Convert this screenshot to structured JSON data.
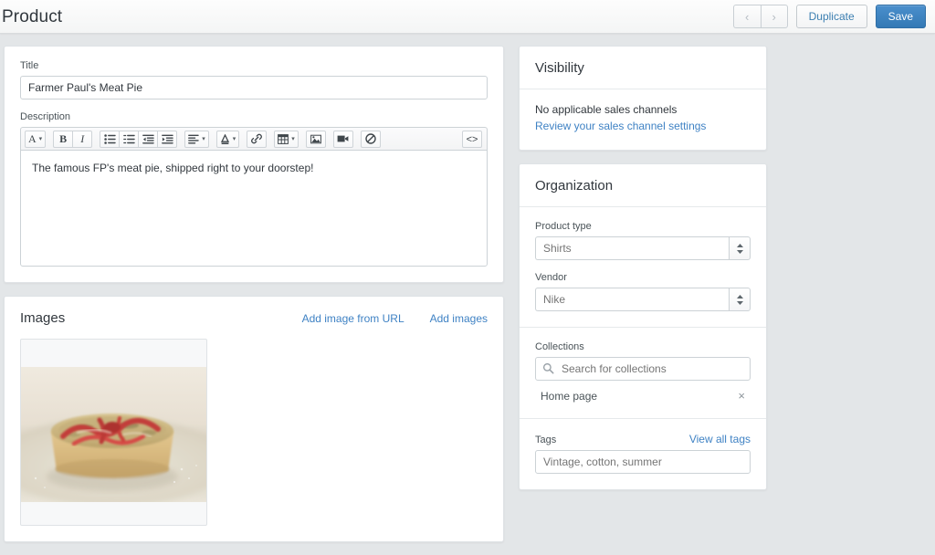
{
  "topbar": {
    "title": "Product",
    "prev_label": "‹",
    "next_label": "›",
    "duplicate_label": "Duplicate",
    "save_label": "Save"
  },
  "product": {
    "title_label": "Title",
    "title_value": "Farmer Paul's Meat Pie",
    "description_label": "Description",
    "description_value": "The famous FP's meat pie, shipped right to your doorstep!"
  },
  "editor_toolbar": {
    "groups": [
      {
        "buttons": [
          {
            "name": "font-style-icon",
            "glyph": "A",
            "caret": true
          }
        ]
      },
      {
        "buttons": [
          {
            "name": "bold-icon",
            "glyph": "B",
            "caret": false
          },
          {
            "name": "italic-icon",
            "glyph": "I",
            "caret": false
          }
        ]
      },
      {
        "buttons": [
          {
            "name": "bulleted-list-icon",
            "glyph": "",
            "caret": false
          },
          {
            "name": "numbered-list-icon",
            "glyph": "",
            "caret": false
          },
          {
            "name": "outdent-icon",
            "glyph": "",
            "caret": false
          },
          {
            "name": "indent-icon",
            "glyph": "",
            "caret": false
          }
        ]
      },
      {
        "buttons": [
          {
            "name": "align-icon",
            "glyph": "",
            "caret": true
          }
        ]
      },
      {
        "buttons": [
          {
            "name": "text-color-icon",
            "glyph": "A",
            "caret": true
          }
        ]
      },
      {
        "buttons": [
          {
            "name": "link-icon",
            "glyph": "",
            "caret": false
          }
        ]
      },
      {
        "buttons": [
          {
            "name": "table-icon",
            "glyph": "",
            "caret": true
          }
        ]
      },
      {
        "buttons": [
          {
            "name": "insert-image-icon",
            "glyph": "",
            "caret": false
          }
        ]
      },
      {
        "buttons": [
          {
            "name": "insert-video-icon",
            "glyph": "",
            "caret": false
          }
        ]
      },
      {
        "buttons": [
          {
            "name": "clear-formatting-icon",
            "glyph": "",
            "caret": false
          }
        ]
      }
    ],
    "html_toggle_label": "<>"
  },
  "images": {
    "title": "Images",
    "add_from_url_label": "Add image from URL",
    "add_images_label": "Add images",
    "thumbnail_alt": "meat pie on plate"
  },
  "visibility": {
    "title": "Visibility",
    "status_text": "No applicable sales channels",
    "link_text": "Review your sales channel settings"
  },
  "organization": {
    "title": "Organization",
    "product_type_label": "Product type",
    "product_type_placeholder": "Shirts",
    "vendor_label": "Vendor",
    "vendor_placeholder": "Nike",
    "collections_label": "Collections",
    "collections_placeholder": "Search for collections",
    "collection_items": [
      {
        "name": "Home page",
        "remove_label": "×"
      }
    ],
    "tags_label": "Tags",
    "view_all_tags_label": "View all tags",
    "tags_placeholder": "Vintage, cotton, summer"
  },
  "colors": {
    "accent_blue": "#3f82c4",
    "primary_button": "#3479b5",
    "page_bg": "#e3e6e8",
    "text": "#31373d"
  }
}
